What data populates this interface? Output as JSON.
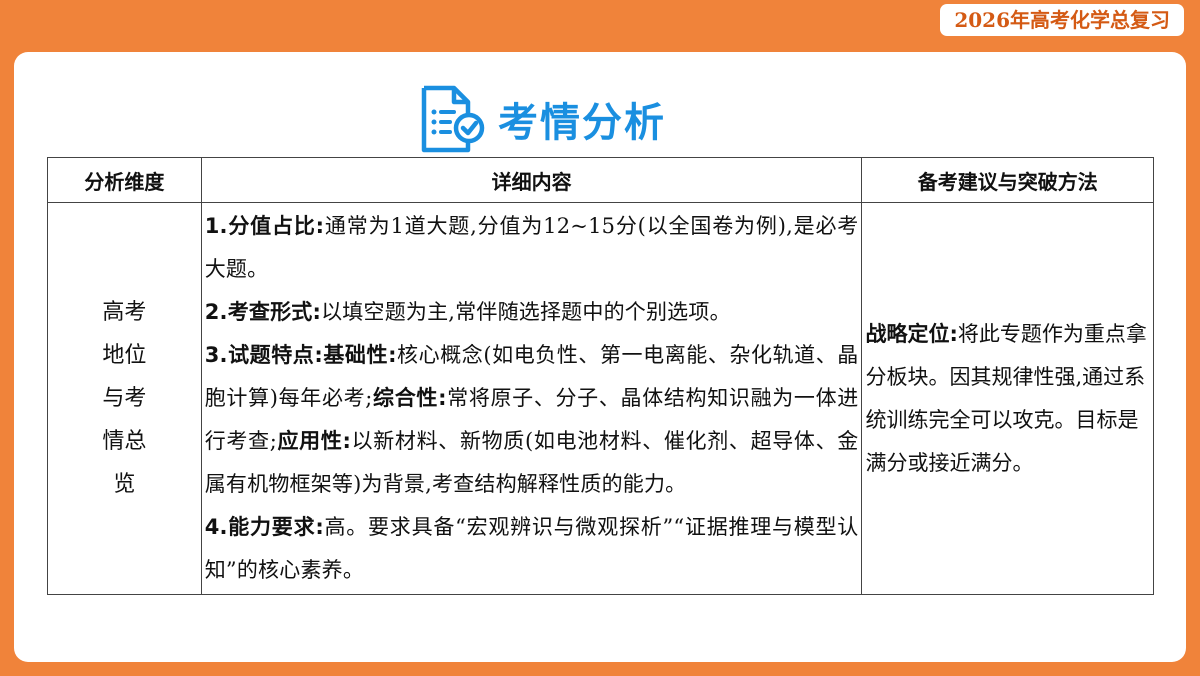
{
  "header": {
    "course_tag": "2026年高考化学总复习"
  },
  "section": {
    "icon": "document-check-icon",
    "title": "考情分析"
  },
  "table": {
    "headers": [
      "分析维度",
      "详细内容",
      "备考建议与突破方法"
    ],
    "dimension_lines": [
      "高考",
      "地位",
      "与考",
      "情总",
      "览"
    ],
    "points": [
      {
        "label": "1.分值占比:",
        "text": "通常为1道大题,分值为12~15分(以全国卷为例),是必考大题。"
      },
      {
        "label": "2.考查形式:",
        "text": "以填空题为主,常伴随选择题中的个别选项。"
      },
      {
        "label": "3.试题特点:",
        "parts": [
          {
            "label": "基础性:",
            "text": "核心概念(如电负性、第一电离能、杂化轨道、晶胞计算)每年必考;"
          },
          {
            "label": "综合性:",
            "text": "常将原子、分子、晶体结构知识融为一体进行考查;"
          },
          {
            "label": "应用性:",
            "text": "以新材料、新物质(如电池材料、催化剂、超导体、金属有机物框架等)为背景,考查结构解释性质的能力。"
          }
        ]
      },
      {
        "label": "4.能力要求:",
        "text": "高。要求具备“宏观辨识与微观探析”“证据推理与模型认知”的核心素养。"
      }
    ],
    "advice": {
      "label": "战略定位:",
      "text": "将此专题作为重点拿分板块。因其规律性强,通过系统训练完全可以攻克。目标是满分或接近满分。"
    }
  },
  "colors": {
    "frame": "#f0833a",
    "title": "#1a8fe0",
    "tag_text": "#d45a14"
  }
}
